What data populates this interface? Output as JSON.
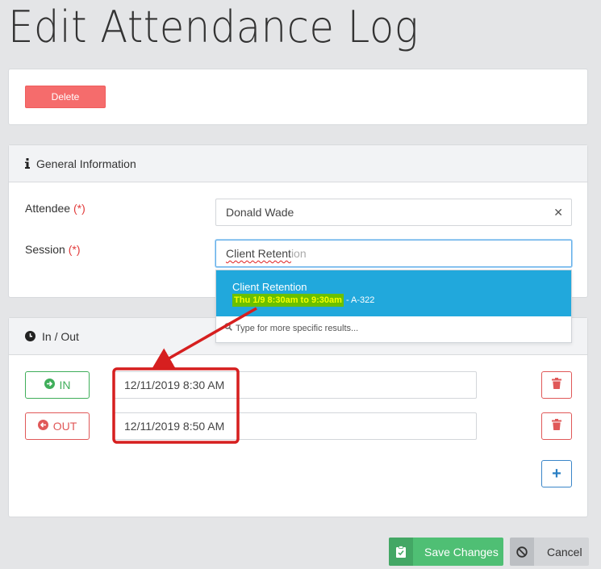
{
  "page": {
    "title": "Edit Attendance Log"
  },
  "actions": {
    "delete_label": "Delete"
  },
  "general": {
    "header": "General Information",
    "attendee_label": "Attendee",
    "required_mark": "(*)",
    "attendee_value": "Donald Wade",
    "clear_symbol": "✕",
    "session_label": "Session",
    "session_typed": "Client Retent",
    "session_ghost": "ion",
    "dropdown": {
      "option_title": "Client Retention",
      "option_time": "Thu 1/9 8:30am to 9:30am",
      "option_suffix": " - A-322",
      "hint": "Type for more specific results..."
    }
  },
  "inout": {
    "header": "In / Out",
    "in_label": "IN",
    "out_label": "OUT",
    "in_time": "12/11/2019 8:30 AM",
    "out_time": "12/11/2019 8:50 AM",
    "add_symbol": "+"
  },
  "footer": {
    "save_label": "Save Changes",
    "cancel_label": "Cancel"
  },
  "colors": {
    "delete": "#f56c6c",
    "save": "#4fbf74",
    "dropdown_active": "#21a8dc",
    "in": "#3fae5a",
    "out": "#e05858",
    "annotation": "#d61f1f"
  }
}
